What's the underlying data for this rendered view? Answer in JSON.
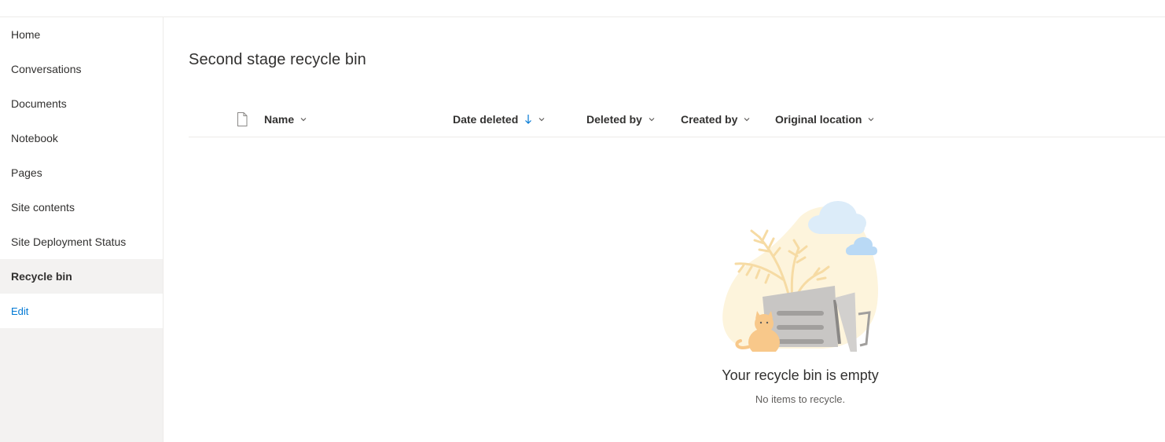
{
  "sidebar": {
    "items": [
      {
        "label": "Home"
      },
      {
        "label": "Conversations"
      },
      {
        "label": "Documents"
      },
      {
        "label": "Notebook"
      },
      {
        "label": "Pages"
      },
      {
        "label": "Site contents"
      },
      {
        "label": "Site Deployment Status"
      },
      {
        "label": "Recycle bin",
        "selected": true
      }
    ],
    "edit_label": "Edit"
  },
  "main": {
    "title": "Second stage recycle bin",
    "columns": {
      "name": "Name",
      "date_deleted": "Date deleted",
      "deleted_by": "Deleted by",
      "created_by": "Created by",
      "original_location": "Original location"
    },
    "sort": {
      "column": "date_deleted",
      "direction": "descending"
    },
    "empty": {
      "title": "Your recycle bin is empty",
      "subtitle": "No items to recycle."
    }
  },
  "icons": {
    "file": "document-icon",
    "chevron": "chevron-down-icon",
    "sort": "arrow-down-icon"
  },
  "colors": {
    "accent": "#0078d4",
    "selected_bg": "#f3f2f1"
  }
}
